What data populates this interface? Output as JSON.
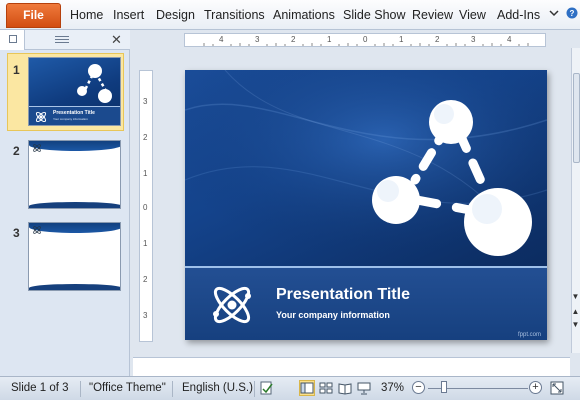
{
  "ribbon": {
    "file_label": "File",
    "tabs": [
      "Home",
      "Insert",
      "Design",
      "Transitions",
      "Animations",
      "Slide Show",
      "Review",
      "View",
      "Add-Ins"
    ],
    "options_icon": "chevron-down-icon",
    "help_icon": "help-icon"
  },
  "slides_panel": {
    "tabs": [
      "slides-tab-icon",
      "outline-tab-icon"
    ],
    "close_icon": "close-icon",
    "thumbnails": [
      {
        "number": "1",
        "title": "Presentation   Title",
        "subtitle": "Your company information"
      },
      {
        "number": "2"
      },
      {
        "number": "3"
      }
    ]
  },
  "rulers": {
    "horizontal": [
      "4",
      "3",
      "2",
      "1",
      "0",
      "1",
      "2",
      "3",
      "4"
    ],
    "vertical": [
      "3",
      "2",
      "1",
      "0",
      "1",
      "2",
      "3"
    ]
  },
  "slide": {
    "title": "Presentation Title",
    "subtitle": "Your company information",
    "watermark": "fppt.com",
    "colors": {
      "background": "#14438b",
      "band": "#1b4a8e",
      "accent": "#9ec0ea"
    }
  },
  "status": {
    "slide_info": "Slide 1 of 3",
    "theme": "\"Office Theme\"",
    "language": "English (U.S.)",
    "zoom": "37%",
    "zoom_minus": "−",
    "zoom_plus": "+"
  },
  "colors": {
    "file_tab": "#d24d12",
    "selected_thumb": "#fbe7a2"
  }
}
